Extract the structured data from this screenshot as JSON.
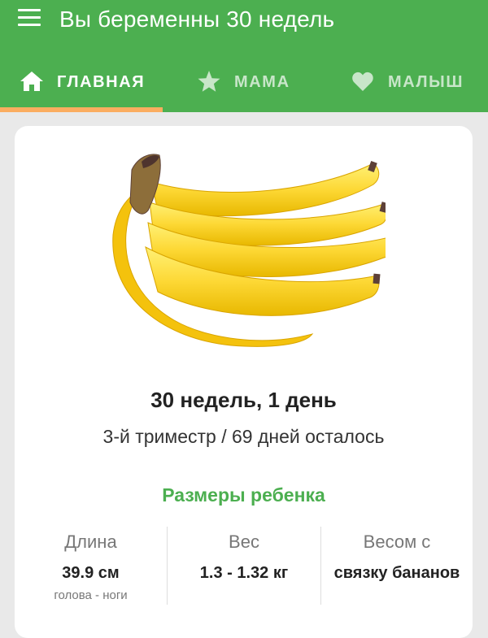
{
  "header": {
    "title": "Вы беременны 30 недель"
  },
  "tabs": [
    {
      "label": "ГЛАВНАЯ",
      "icon": "home-icon",
      "active": true
    },
    {
      "label": "МАМА",
      "icon": "star-icon",
      "active": false
    },
    {
      "label": "МАЛЫШ",
      "icon": "heart-icon",
      "active": false
    }
  ],
  "card": {
    "image": "banana-bunch-image",
    "week_text": "30 недель, 1 день",
    "trimester_text": "3-й триместр / 69 дней осталось",
    "sizes_title": "Размеры ребенка",
    "stats": [
      {
        "label": "Длина",
        "value": "39.9 см",
        "sub": "голова - ноги"
      },
      {
        "label": "Вес",
        "value": "1.3 - 1.32 кг",
        "sub": ""
      },
      {
        "label": "Весом с",
        "value": "связку бананов",
        "sub": ""
      }
    ]
  },
  "colors": {
    "primary": "#4caf50",
    "accent": "#fbad60",
    "tab_inactive": "#c8e6c9",
    "background": "#e9e9e9"
  }
}
